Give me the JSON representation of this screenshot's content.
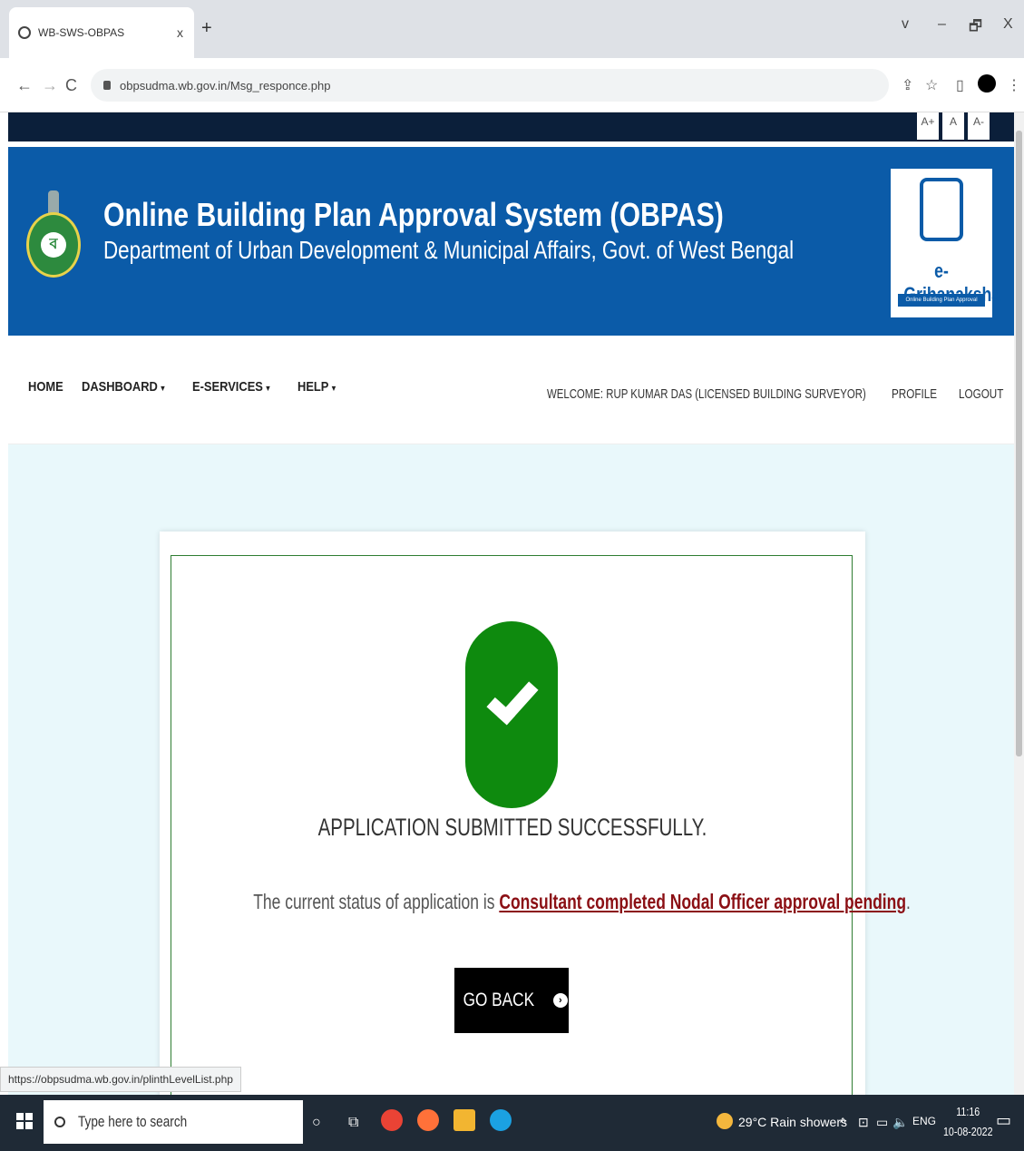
{
  "browser": {
    "tab_title": "WB-SWS-OBPAS",
    "tab_close": "x",
    "new_tab": "+",
    "window_controls": [
      "v",
      "–",
      "🗗",
      "X"
    ],
    "url": "obpsudma.wb.gov.in/Msg_responce.php",
    "status_url": "https://obpsudma.wb.gov.in/plinthLevelList.php"
  },
  "font_size": [
    "A+",
    "A",
    "A-"
  ],
  "header": {
    "title": "Online Building Plan Approval System (OBPAS)",
    "subtitle": "Department of Urban Development & Municipal Affairs, Govt. of West Bengal",
    "emblem_letter": "ব",
    "logo_brand": "e-Grihanaksha",
    "logo_tagline": "Online Building Plan Approval System"
  },
  "nav": {
    "home": "HOME",
    "dashboard": "DASHBOARD",
    "eservices": "E-SERVICES",
    "help": "HELP",
    "caret": "▼",
    "welcome": "WELCOME: RUP KUMAR DAS (LICENSED BUILDING SURVEYOR)",
    "profile": "PROFILE",
    "logout": "LOGOUT"
  },
  "result": {
    "message": "APPLICATION SUBMITTED SUCCESSFULLY.",
    "status_prefix": "The current status of application is ",
    "status_value": "Consultant completed Nodal Officer approval pending",
    "status_suffix": ".",
    "go_back": "GO BACK"
  },
  "taskbar": {
    "search_placeholder": "Type here to search",
    "weather": "29°C  Rain showers",
    "language": "ENG",
    "time": "11:16",
    "date": "10-08-2022"
  },
  "colors": {
    "header_blue": "#0b5ba8",
    "success_green": "#0e8a0e",
    "status_red": "#8b0f14",
    "content_bg": "#e9f8fb"
  }
}
